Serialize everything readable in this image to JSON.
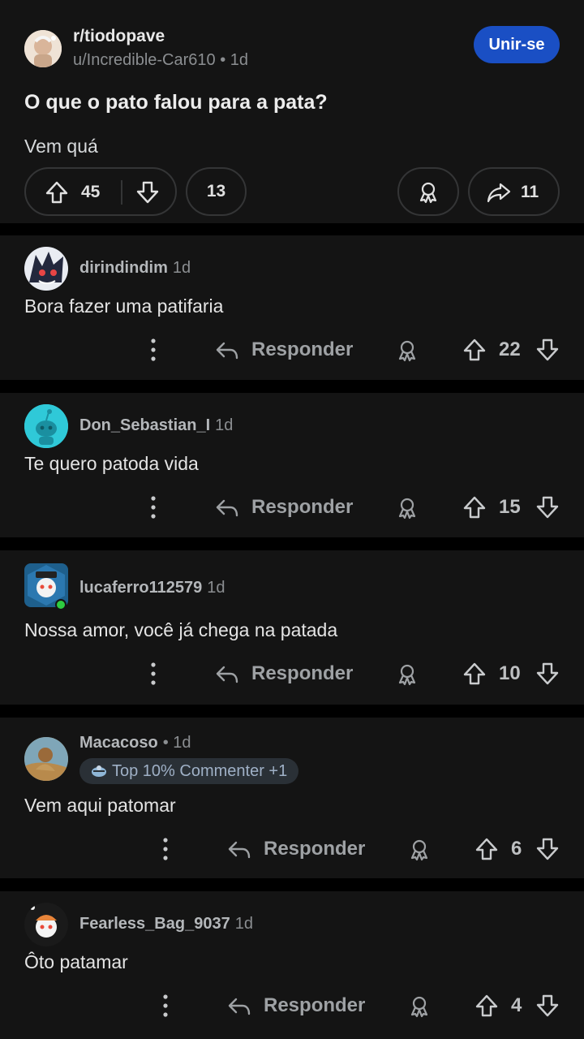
{
  "post": {
    "subreddit": "r/tiodopave",
    "author": "u/Incredible-Car610",
    "age": "1d",
    "join_label": "Unir-se",
    "title": "O que o pato falou para a pata?",
    "body": "Vem quá",
    "score": "45",
    "comments": "13",
    "shares": "11"
  },
  "comments": [
    {
      "user": "dirindindim",
      "age": "1d",
      "text": "Bora fazer uma patifaria",
      "reply_label": "Responder",
      "score": "22"
    },
    {
      "user": "Don_Sebastian_I",
      "age": "1d",
      "text": "Te quero patoda vida",
      "reply_label": "Responder",
      "score": "15"
    },
    {
      "user": "lucaferro112579",
      "age": "1d",
      "text": "Nossa amor, você já chega na patada",
      "reply_label": "Responder",
      "score": "10"
    },
    {
      "user": "Macacoso",
      "age": "• 1d",
      "badge": "Top 10% Commenter +1",
      "text": "Vem aqui patomar",
      "reply_label": "Responder",
      "score": "6"
    },
    {
      "user": "Fearless_Bag_9037",
      "age": "1d",
      "text": "Ôto patamar",
      "reply_label": "Responder",
      "score": "4"
    }
  ],
  "colors": {
    "background": "#000000",
    "card": "#141414",
    "join": "#1a4fc4",
    "online": "#2ecc40"
  }
}
